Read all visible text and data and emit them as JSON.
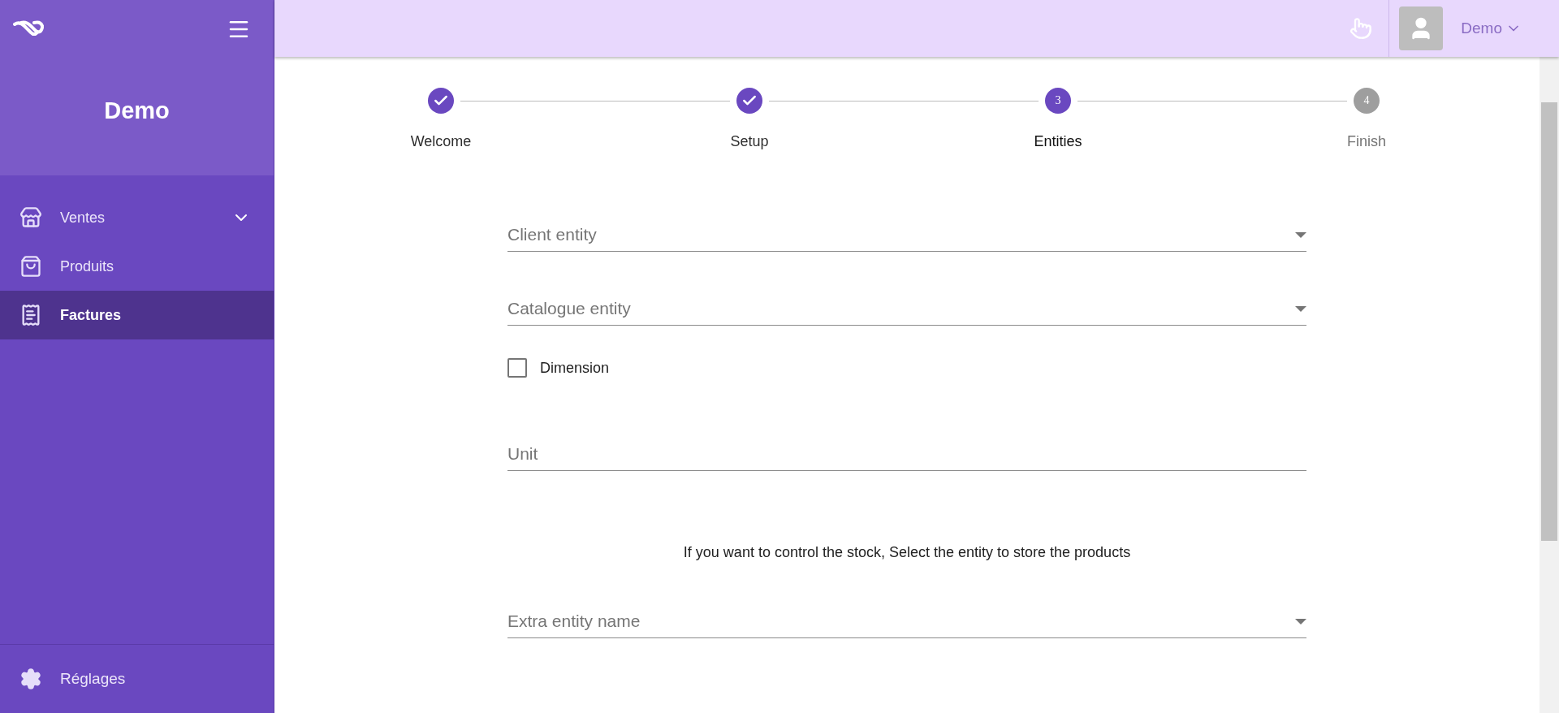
{
  "sidebar": {
    "title": "Demo",
    "items": [
      {
        "label": "Ventes",
        "expandable": true,
        "selected": false
      },
      {
        "label": "Produits",
        "expandable": false,
        "selected": false
      },
      {
        "label": "Factures",
        "expandable": false,
        "selected": true
      }
    ],
    "footer": {
      "label": "Réglages"
    }
  },
  "header": {
    "user": "Demo"
  },
  "stepper": [
    {
      "label": "Welcome",
      "completed": true,
      "selected": false
    },
    {
      "label": "Setup",
      "completed": true,
      "selected": false
    },
    {
      "label": "Entities",
      "number": "3",
      "completed": false,
      "selected": true
    },
    {
      "label": "Finish",
      "number": "4",
      "completed": false,
      "selected": false
    }
  ],
  "form": [
    {
      "kind": "select",
      "placeholder": "Client entity"
    },
    {
      "kind": "select",
      "placeholder": "Catalogue entity"
    },
    {
      "kind": "checkbox",
      "label": "Dimension",
      "checked": false
    },
    {
      "kind": "text",
      "placeholder": "Unit"
    },
    {
      "kind": "note",
      "text": "If you want to control the stock, Select the entity to store the products"
    },
    {
      "kind": "select",
      "placeholder": "Extra entity name"
    }
  ]
}
